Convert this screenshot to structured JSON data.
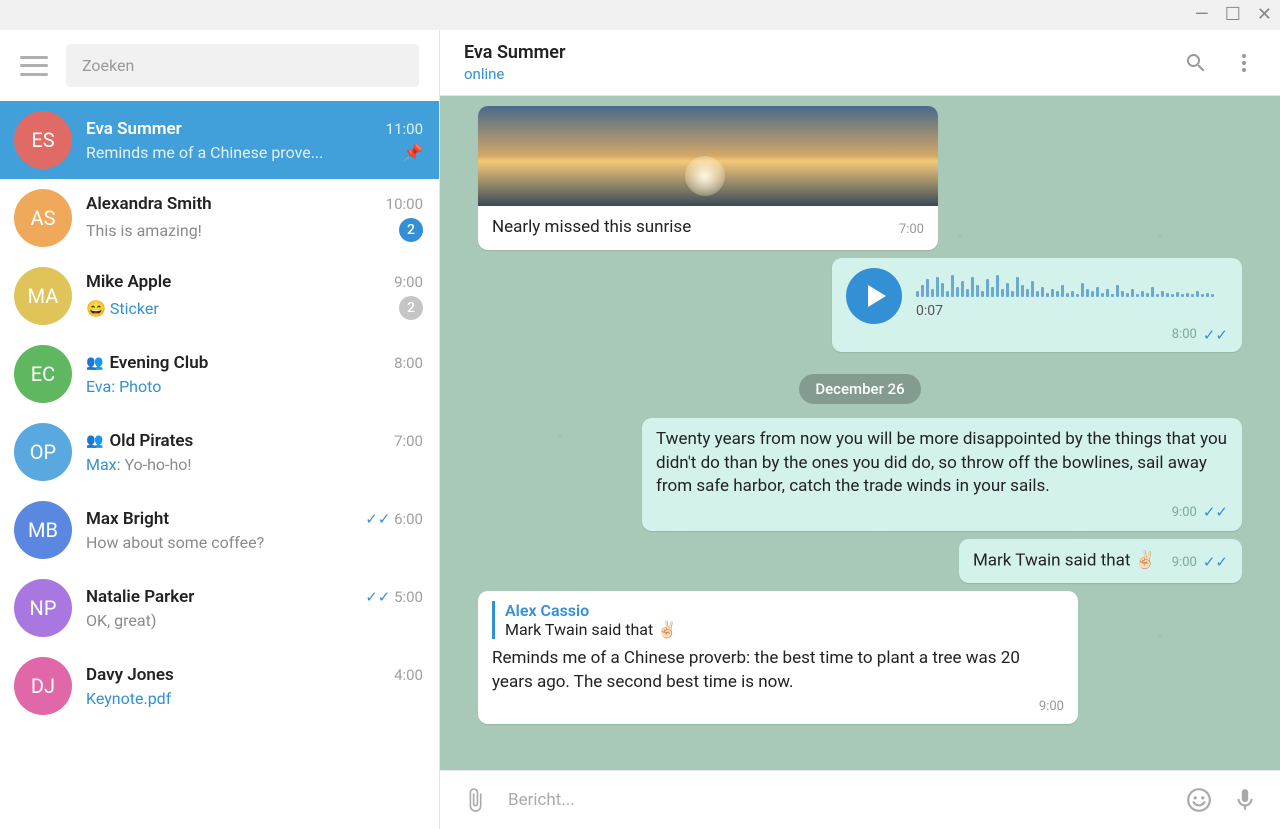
{
  "search_placeholder": "Zoeken",
  "chats": [
    {
      "initials": "ES",
      "name": "Eva Summer",
      "time": "11:00",
      "preview": "Reminds me of a Chinese prove...",
      "color": "#e06b66",
      "active": true,
      "pinned": true
    },
    {
      "initials": "AS",
      "name": "Alexandra Smith",
      "time": "10:00",
      "preview": "This is amazing!",
      "color": "#f0a85a",
      "badge": "2"
    },
    {
      "initials": "MA",
      "name": "Mike Apple",
      "time": "9:00",
      "preview_emoji": "😄",
      "preview_link": "Sticker",
      "color": "#e0c45a",
      "badge": "2",
      "badge_muted": true
    },
    {
      "initials": "EC",
      "name": "Evening Club",
      "time": "8:00",
      "sender": "Eva:",
      "preview_link": "Photo",
      "color": "#5fb85f",
      "group": true
    },
    {
      "initials": "OP",
      "name": "Old Pirates",
      "time": "7:00",
      "sender": "Max:",
      "preview": "Yo-ho-ho!",
      "color": "#5aa8e0",
      "group": true
    },
    {
      "initials": "MB",
      "name": "Max Bright",
      "time": "6:00",
      "preview": "How about some coffee?",
      "color": "#5a88e0",
      "ticks": true
    },
    {
      "initials": "NP",
      "name": "Natalie Parker",
      "time": "5:00",
      "preview": "OK, great)",
      "color": "#a878e0",
      "ticks": true
    },
    {
      "initials": "DJ",
      "name": "Davy Jones",
      "time": "4:00",
      "preview_link": "Keynote.pdf",
      "color": "#e068a8"
    }
  ],
  "header": {
    "name": "Eva Summer",
    "status": "online"
  },
  "date_chip": "December 26",
  "composer_placeholder": "Bericht...",
  "msg_photo": {
    "caption": "Nearly missed this sunrise",
    "time": "7:00"
  },
  "msg_voice": {
    "duration": "0:07",
    "time": "8:00"
  },
  "msg_quote": {
    "text": "Twenty years from now you will be more disappointed by the things that you didn't do than by the ones you did do, so throw off the bowlines, sail away from safe harbor, catch the trade winds in your sails.",
    "time": "9:00"
  },
  "msg_twain": {
    "text": "Mark Twain said that ✌🏻",
    "time": "9:00"
  },
  "msg_reply": {
    "reply_name": "Alex Cassio",
    "reply_text": "Mark Twain said that ✌🏻",
    "text": "Reminds me of a Chinese proverb: the best time to plant a tree was 20 years ago. The second best time is now.",
    "time": "9:00"
  }
}
